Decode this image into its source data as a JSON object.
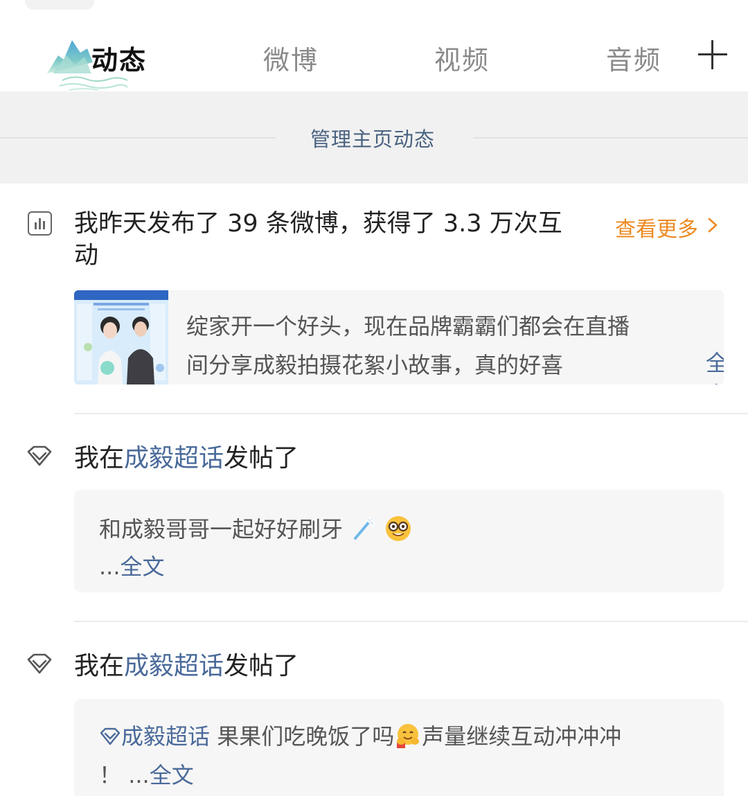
{
  "tabs": {
    "items": [
      {
        "label": "动态",
        "active": true
      },
      {
        "label": "微博",
        "active": false
      },
      {
        "label": "视频",
        "active": false
      },
      {
        "label": "音频",
        "active": false
      }
    ],
    "add_icon": "plus-icon"
  },
  "manage": {
    "label": "管理主页动态"
  },
  "stats": {
    "line1": "我昨天发布了 39 条微博，获得了 3.3 万次互",
    "line2": "动",
    "more_label": "查看更多",
    "icon": "bar-chart-icon"
  },
  "shared_post": {
    "line1": "绽家开一个好头，现在品牌霸霸们都会在直播",
    "line2": "间分享成毅拍摄花絮小故事，真的好喜",
    "full_label": "全文"
  },
  "activity1": {
    "prefix": "我在",
    "topic": "成毅超话",
    "suffix": "发帖了",
    "text": "和成毅哥哥一起好好刷牙",
    "emojis": [
      "toothbrush",
      "nerd-face"
    ],
    "ellipsis": "...",
    "full_label": "全文"
  },
  "activity2": {
    "prefix": "我在",
    "topic": "成毅超话",
    "suffix": "发帖了",
    "inline_topic": "成毅超话",
    "text_a": "果果们吃晚饭了吗",
    "text_b": "声量继续互动冲冲冲",
    "text_c": "！",
    "ellipsis": "...",
    "full_label": "全文",
    "emojis": [
      "hugging-face"
    ]
  },
  "colors": {
    "link": "#4a6a9a",
    "orange": "#ec8a22",
    "band": "#f1f1f1",
    "card": "#f6f6f6"
  }
}
